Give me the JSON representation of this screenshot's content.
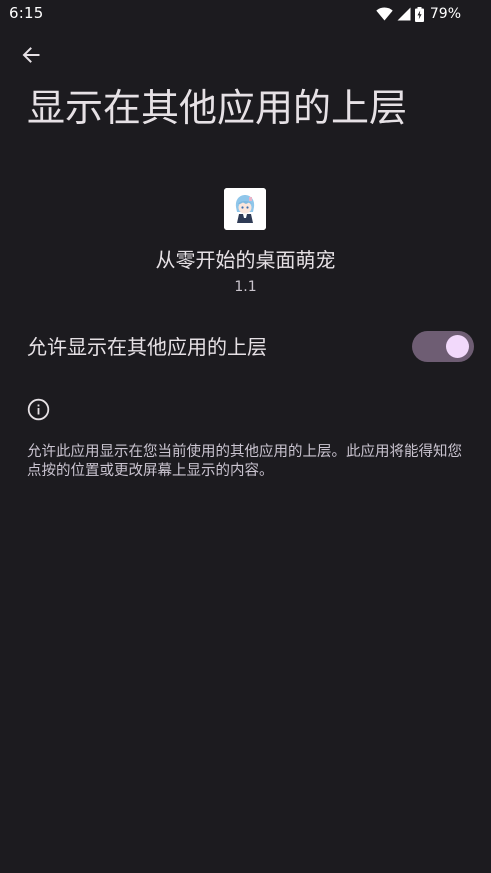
{
  "status_bar": {
    "time": "6:15",
    "battery_percent": "79%",
    "icons": [
      "wifi-icon",
      "cellular-signal-icon",
      "battery-charging-icon"
    ]
  },
  "header": {
    "back_icon": "arrow-back-icon",
    "title": "显示在其他应用的上层"
  },
  "app": {
    "name": "从零开始的桌面萌宠",
    "version": "1.1"
  },
  "permission_setting": {
    "label": "允许显示在其他应用的上层",
    "enabled": true
  },
  "info": {
    "icon": "info-icon",
    "description": "允许此应用显示在您当前使用的其他应用的上层。此应用将能得知您点按的位置或更改屏幕上显示的内容。"
  },
  "colors": {
    "background": "#1c1b1f",
    "toggle_track": "#6e5d73",
    "toggle_thumb": "#f2d9fb",
    "text_primary": "#e6e1e5",
    "text_secondary": "#cac4d0"
  }
}
